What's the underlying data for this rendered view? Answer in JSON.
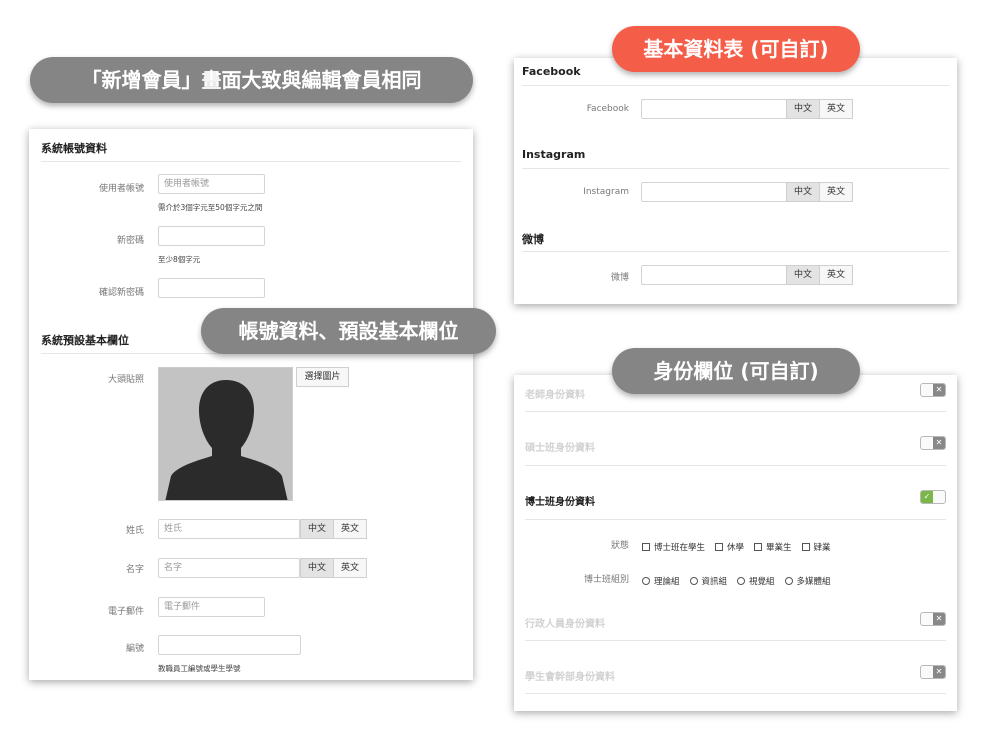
{
  "callouts": {
    "top_left": "「新增會員」畫面大致與編輯會員相同",
    "middle": "帳號資料、預設基本欄位",
    "top_right": "基本資料表 (可自訂)",
    "bottom_right": "身份欄位 (可自訂)"
  },
  "account_section": {
    "title": "系統帳號資料",
    "username_label": "使用者帳號",
    "username_placeholder": "使用者帳號",
    "username_hint": "需介於3個字元至50個字元之間",
    "password_label": "新密碼",
    "password_hint": "至少8個字元",
    "confirm_label": "確認新密碼"
  },
  "basic_section": {
    "title": "系統預設基本欄位",
    "photo_label": "大頭貼照",
    "choose_photo_button": "選擇圖片",
    "surname_label": "姓氏",
    "surname_placeholder": "姓氏",
    "given_label": "名字",
    "given_placeholder": "名字",
    "email_label": "電子郵件",
    "email_placeholder": "電子郵件",
    "number_label": "編號",
    "number_hint": "教職員工編號或學生學號",
    "lang_zh": "中文",
    "lang_en": "英文"
  },
  "social": {
    "facebook_title": "Facebook",
    "facebook_label": "Facebook",
    "instagram_title": "Instagram",
    "instagram_label": "Instagram",
    "weibo_title": "微博",
    "weibo_label": "微博",
    "lang_zh": "中文",
    "lang_en": "英文"
  },
  "identity": {
    "teacher": "老師身份資料",
    "master": "碩士班身份資料",
    "phd": "博士班身份資料",
    "status_label": "狀態",
    "status_options": [
      "博士班在學生",
      "休學",
      "畢業生",
      "肄業"
    ],
    "group_label": "博士班組別",
    "group_options": [
      "理論組",
      "資訊組",
      "視覺組",
      "多媒體組"
    ],
    "admin": "行政人員身份資料",
    "student_council": "學生會幹部身份資料",
    "toggle_off_glyph": "✕",
    "toggle_on_glyph": "✓"
  },
  "colors": {
    "callout_gray": "#858585",
    "callout_red": "#f45d48",
    "toggle_on": "#7bb649",
    "toggle_off": "#888888"
  }
}
